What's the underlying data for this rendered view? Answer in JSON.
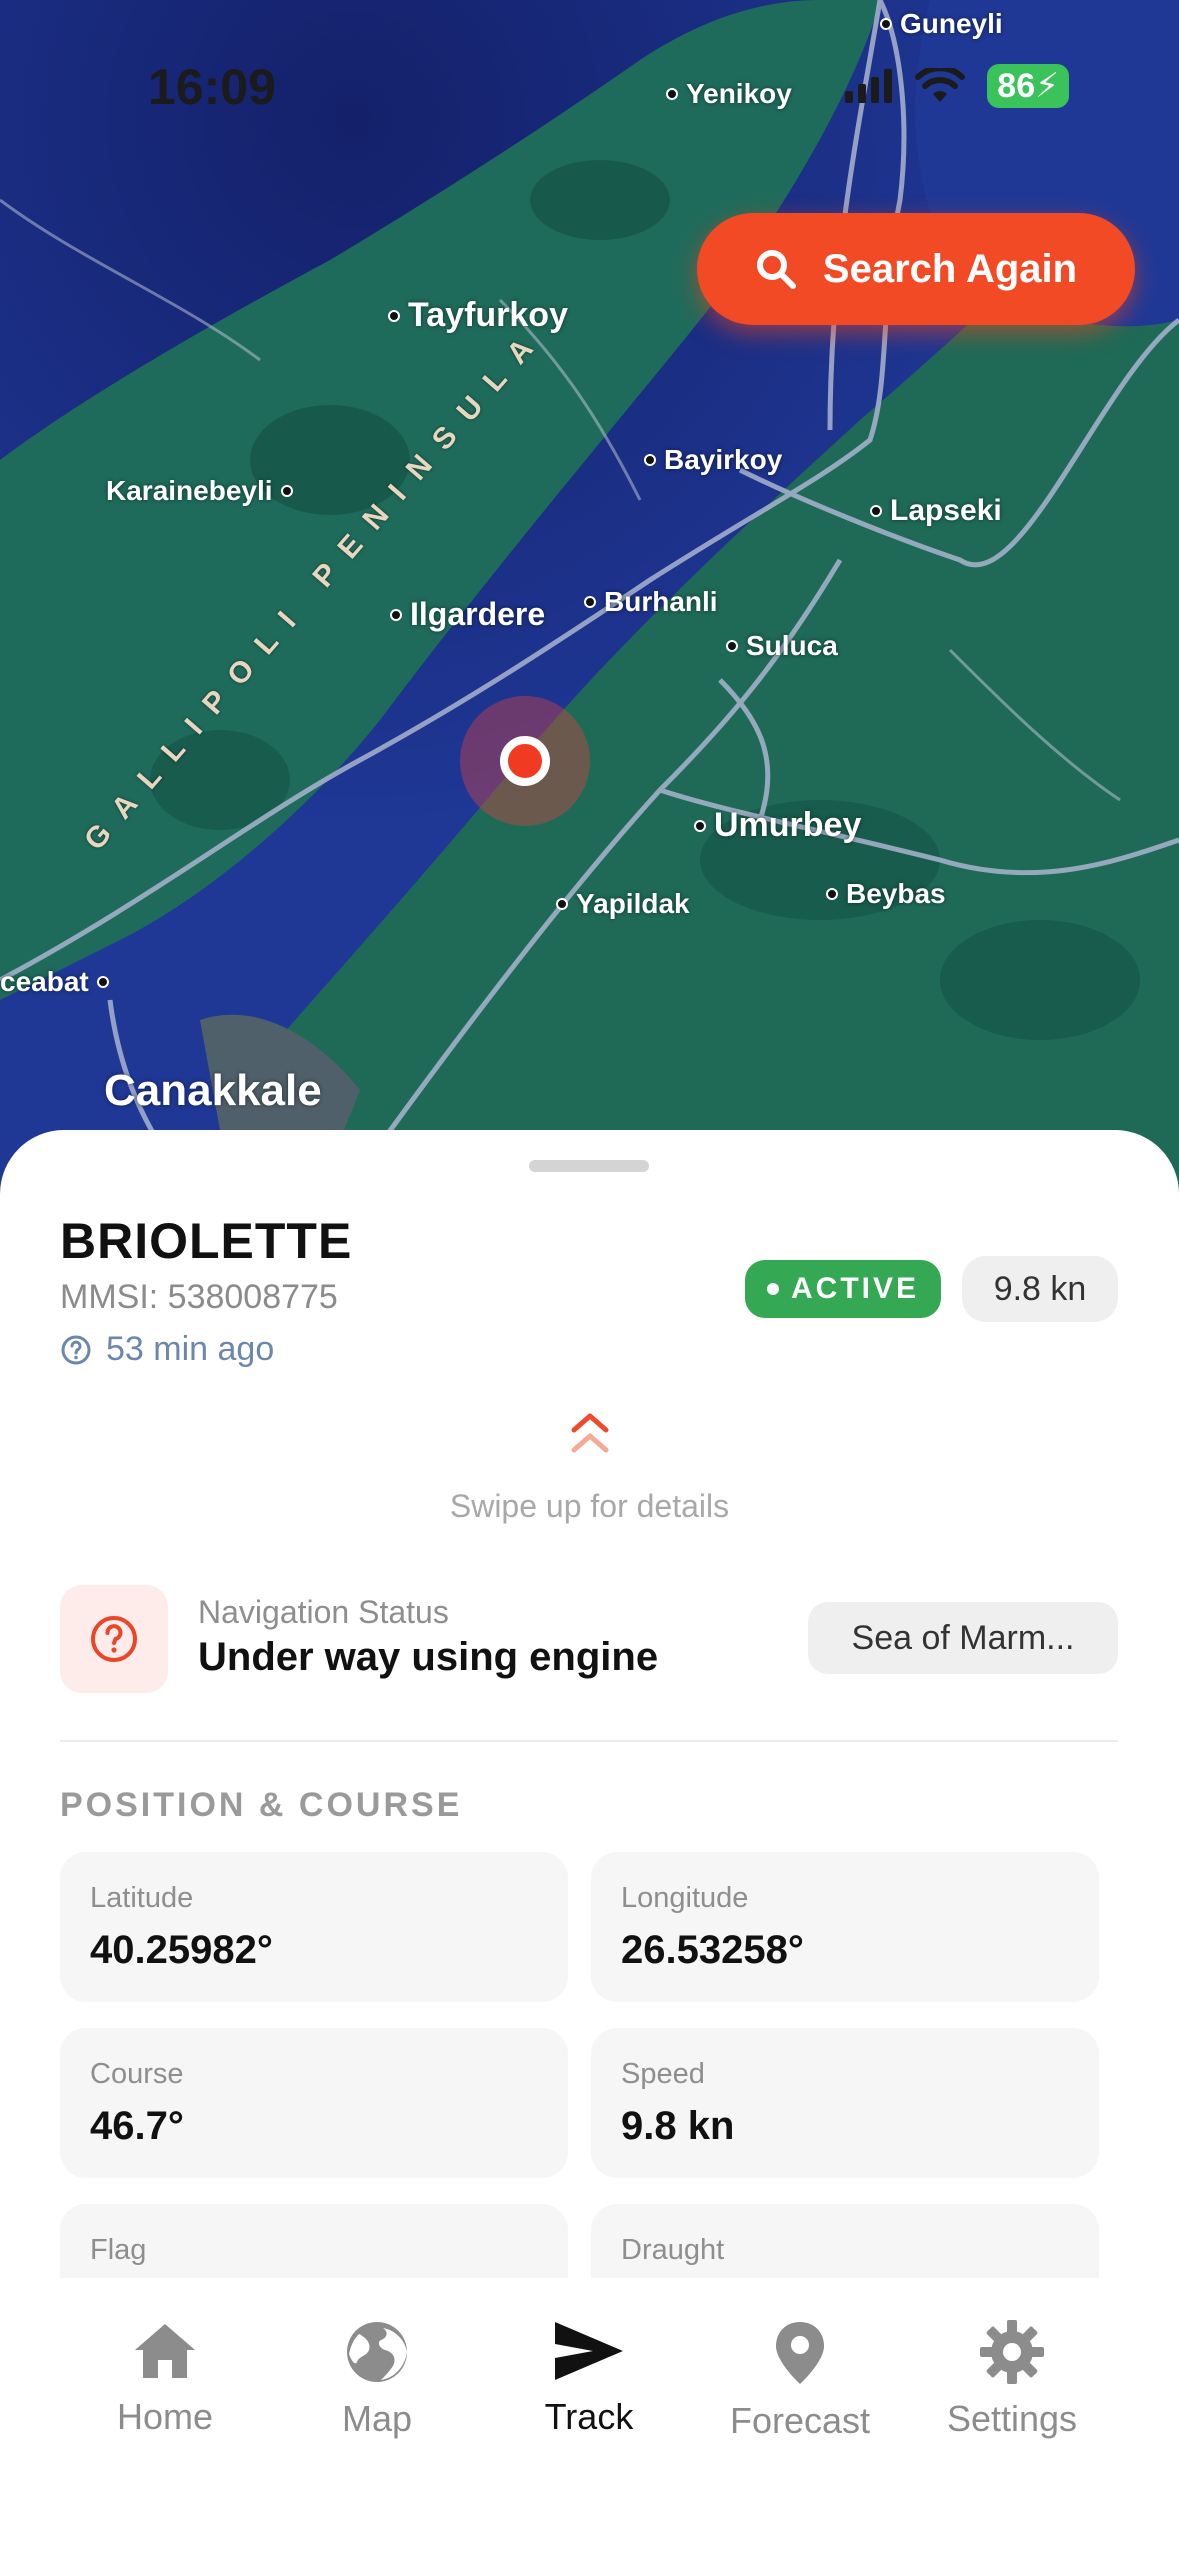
{
  "status_bar": {
    "time": "16:09",
    "battery": "86"
  },
  "map": {
    "search_button": "Search Again",
    "peninsula_label": "GALLIPOLI PENINSULA",
    "places": {
      "guneyli": "Guneyli",
      "yenikoy": "Yenikoy",
      "tayfurkoy": "Tayfurkoy",
      "karainebeyli": "Karainebeyli",
      "bayirkoy": "Bayirkoy",
      "lapseki": "Lapseki",
      "ilgardere": "Ilgardere",
      "burhanli": "Burhanli",
      "suluca": "Suluca",
      "umurbey": "Umurbey",
      "yapildak": "Yapildak",
      "beybas": "Beybas",
      "ceabat": "ceabat",
      "canakkale": "Canakkale"
    }
  },
  "vessel": {
    "name": "BRIOLETTE",
    "mmsi": "MMSI: 538008775",
    "updated": "53 min ago",
    "status_badge": "ACTIVE",
    "speed_badge": "9.8 kn",
    "swipe_hint": "Swipe up for details",
    "navigation_status_label": "Navigation Status",
    "navigation_status_value": "Under way using engine",
    "region": "Sea of Marm..."
  },
  "position_section": {
    "title": "POSITION & COURSE",
    "cards": [
      {
        "label": "Latitude",
        "value": "40.25982°"
      },
      {
        "label": "Longitude",
        "value": "26.53258°"
      },
      {
        "label": "Course",
        "value": "46.7°"
      },
      {
        "label": "Speed",
        "value": "9.8 kn"
      },
      {
        "label": "Flag",
        "value": ""
      },
      {
        "label": "Draught",
        "value": ""
      }
    ]
  },
  "tabs": [
    {
      "label": "Home",
      "icon": "home-icon"
    },
    {
      "label": "Map",
      "icon": "globe-icon"
    },
    {
      "label": "Track",
      "icon": "send-icon",
      "active": true
    },
    {
      "label": "Forecast",
      "icon": "location-pin-icon"
    },
    {
      "label": "Settings",
      "icon": "gear-icon"
    }
  ],
  "colors": {
    "accent": "#f24a24",
    "active": "#34a853",
    "water": "#1b2f86",
    "land": "#1e6b5a"
  }
}
